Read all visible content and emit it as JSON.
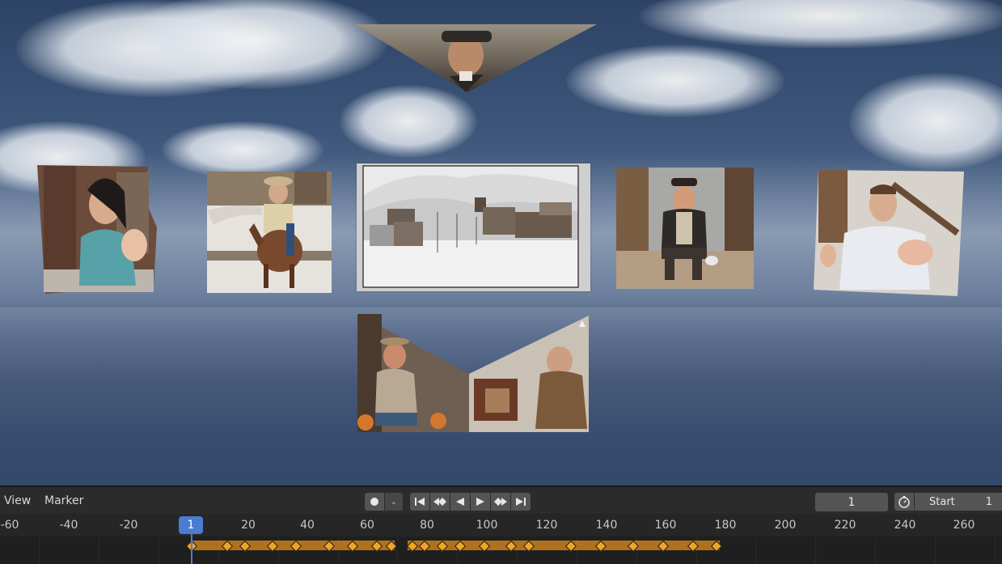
{
  "timeline": {
    "menus": [
      "View",
      "Marker"
    ],
    "current_frame": "1",
    "frame_field_value": "1",
    "start_label": "Start",
    "start_value": "1",
    "ruler_ticks": [
      "-60",
      "-40",
      "-20",
      "20",
      "40",
      "60",
      "80",
      "100",
      "120",
      "140",
      "160",
      "180",
      "200",
      "220",
      "240",
      "260"
    ],
    "transport_icons": [
      "record-icon",
      "record-dropdown-icon",
      "jump-start-icon",
      "prev-keyframe-icon",
      "play-reverse-icon",
      "play-icon",
      "next-keyframe-icon",
      "jump-end-icon"
    ],
    "keyframes": [
      1,
      13,
      19,
      28,
      36,
      47,
      55,
      63,
      68,
      75,
      79,
      85,
      91,
      99,
      108,
      114,
      128,
      138,
      149,
      159,
      169,
      177
    ]
  },
  "colors": {
    "keyframe": "#f0a428",
    "playhead": "#4a7ccf",
    "sky_top": "#2d4466"
  },
  "icons": [
    "stopwatch-icon"
  ]
}
